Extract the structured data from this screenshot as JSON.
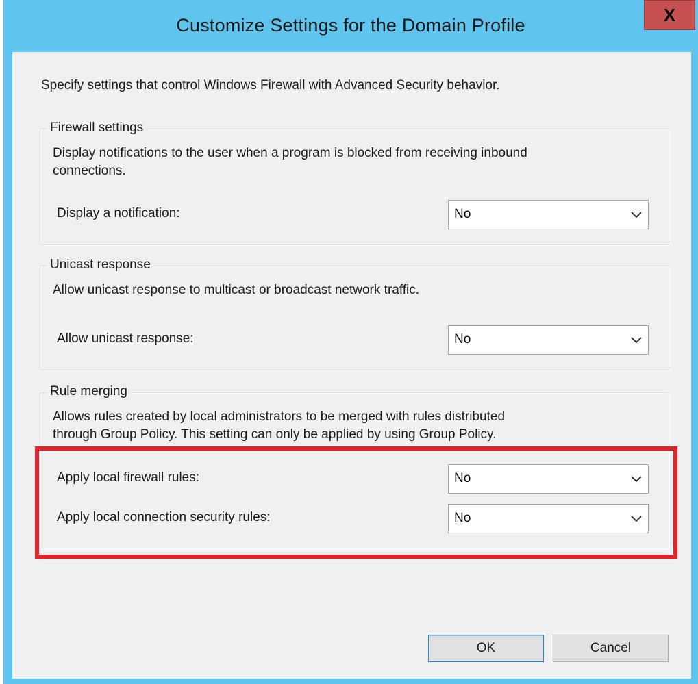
{
  "window": {
    "title": "Customize Settings for the Domain Profile",
    "close_label": "X"
  },
  "description": "Specify settings that control Windows Firewall with Advanced Security behavior.",
  "firewall_settings": {
    "legend": "Firewall settings",
    "text_line1": "Display notifications to the user when a program is blocked from receiving inbound",
    "text_line2": "connections.",
    "notification_label": "Display a notification:",
    "notification_value": "No"
  },
  "unicast_response": {
    "legend": "Unicast response",
    "text": "Allow unicast response to multicast or broadcast network traffic.",
    "label": "Allow unicast response:",
    "value": "No"
  },
  "rule_merging": {
    "legend": "Rule merging",
    "text_line1": "Allows rules created by local administrators to be merged with rules distributed",
    "text_line2": "through Group Policy. This setting can only be applied by using Group Policy.",
    "firewall_rules_label": "Apply local firewall rules:",
    "firewall_rules_value": "No",
    "connection_rules_label": "Apply local connection security rules:",
    "connection_rules_value": "No"
  },
  "buttons": {
    "ok": "OK",
    "cancel": "Cancel"
  },
  "colors": {
    "frame": "#5fc4ee",
    "close": "#c75050",
    "highlight": "#e3232b"
  }
}
